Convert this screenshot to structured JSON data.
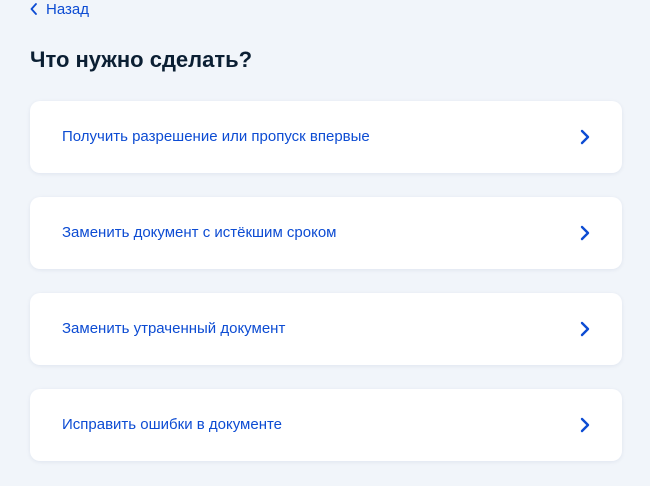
{
  "header": {
    "back_label": "Назад",
    "title": "Что нужно сделать?"
  },
  "options": [
    {
      "label": "Получить разрешение или пропуск впервые",
      "icon": "chevron-right-icon"
    },
    {
      "label": "Заменить документ с истёкшим сроком",
      "icon": "chevron-right-icon"
    },
    {
      "label": "Заменить утраченный документ",
      "icon": "chevron-right-icon"
    },
    {
      "label": "Исправить ошибки в документе",
      "icon": "chevron-right-icon"
    }
  ],
  "colors": {
    "background": "#f1f5fa",
    "accent": "#0d4cd3",
    "text": "#0b1f33",
    "card": "#ffffff"
  }
}
